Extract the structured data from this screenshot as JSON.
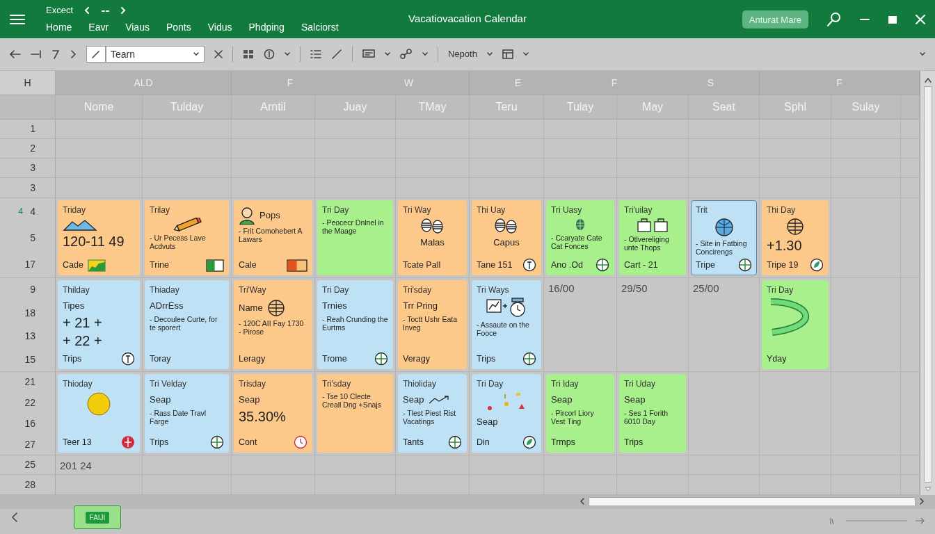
{
  "title_bar": {
    "app_name": "Excect",
    "menu": [
      "Home",
      "Eavr",
      "Viaus",
      "Ponts",
      "Vidus",
      "Phdping",
      "Salciorst"
    ],
    "title": "Vacatiovacation Calendar",
    "account_button": "Anturat Mare"
  },
  "toolbar": {
    "name_field": {
      "value": "Tearn"
    },
    "style_dropdown": "Nepoth"
  },
  "sheet": {
    "corner": "H",
    "column_groups": [
      {
        "labels": [
          "ALD"
        ]
      },
      {
        "labels": [
          "F",
          "W"
        ]
      },
      {
        "labels": [
          "E",
          "F",
          "S"
        ]
      },
      {
        "labels": [
          "F"
        ]
      }
    ],
    "day_headers": [
      "Nome",
      "Tulday",
      "Arntil",
      "Juay",
      "TMay",
      "Teru",
      "Tulay",
      "May",
      "Seat",
      "Sphl",
      "Sulay"
    ],
    "rows": [
      {
        "numbers": [
          "1"
        ]
      },
      {
        "numbers": [
          "2"
        ]
      },
      {
        "numbers": [
          "3"
        ]
      },
      {
        "numbers": [
          "3"
        ]
      },
      {
        "numbers": [
          "4",
          "5",
          "17"
        ],
        "flag": "4",
        "cells": [
          {
            "kind": "card",
            "color": "#fdc98a",
            "selected": false,
            "title": "Triday",
            "values": [
              "120-11 49"
            ],
            "footer": "Cade"
          },
          {
            "kind": "card",
            "color": "#fdc98a",
            "selected": false,
            "title": "Trilay",
            "text": "- Ur Pecess Lave Acdvuts",
            "footer": "Trine"
          },
          {
            "kind": "card",
            "color": "#fdc98a",
            "selected": false,
            "subtitle": "Pops",
            "text": "- Frit Comohebert A Lawars",
            "footer": "Cale"
          },
          {
            "kind": "card",
            "color": "#a8f08c",
            "selected": false,
            "title": "Tri Day",
            "text": "- Peocecr Dnlnel in the Maage"
          },
          {
            "kind": "card",
            "color": "#fdc98a",
            "selected": false,
            "title": "Tri Way",
            "caption": "Malas",
            "footer": "Tcate Pall"
          },
          {
            "kind": "card",
            "color": "#fdc98a",
            "selected": false,
            "title": "Thi Uay",
            "caption": "Capus",
            "footer": "Tane 151"
          },
          {
            "kind": "card",
            "color": "#a8f08c",
            "selected": false,
            "title": "Tri Uasy",
            "text": "- Ccaryate Cate Cat Fonces",
            "footer": "Ano .Od"
          },
          {
            "kind": "card",
            "color": "#a8f08c",
            "selected": false,
            "title": "Tri'uilay",
            "text": "- Otlvereliging unte Thops",
            "footer": "Cart - 21"
          },
          {
            "kind": "card",
            "color": "#bfe1f6",
            "selected": true,
            "title": "Trit",
            "text": "- Site in Fatbing Concirengs",
            "footer": "Tripe"
          },
          {
            "kind": "card",
            "color": "#fdc98a",
            "selected": false,
            "title": "Thi Day",
            "values": [
              "+1.30"
            ],
            "footer": "Tripe 19"
          },
          {
            "kind": "empty"
          }
        ]
      },
      {
        "numbers": [
          "9",
          "18",
          "13",
          "15"
        ],
        "cells": [
          {
            "kind": "card",
            "color": "#bfe1f6",
            "selected": false,
            "title": "Thilday",
            "subtitle": "Tipes",
            "values": [
              "+ 21 +",
              "+ 22 +"
            ],
            "footer": "Trips"
          },
          {
            "kind": "card",
            "color": "#bfe1f6",
            "selected": false,
            "title": "Thiaday",
            "subtitle": "ADrrEss",
            "text": "- Decoulee Curte, for te sporert",
            "footer": "Toray"
          },
          {
            "kind": "card",
            "color": "#fdc98a",
            "selected": false,
            "title": "Tri'Way",
            "subtitle": "Name",
            "text": "- 120C AII Fay 1730 - Pirose",
            "footer": "Leragy"
          },
          {
            "kind": "card",
            "color": "#bfe1f6",
            "selected": false,
            "title": "Tri Day",
            "subtitle": "Trnies",
            "text": "- Reah Crunding the Eurtms",
            "footer": "Trome"
          },
          {
            "kind": "card",
            "color": "#fdc98a",
            "selected": false,
            "title": "Tri'sday",
            "subtitle": "Trr Pring",
            "text": "- Toctt Ushr Eata Inveg",
            "footer": "Veragy"
          },
          {
            "kind": "card",
            "color": "#bfe1f6",
            "selected": false,
            "title": "Tri Ways",
            "text": "- Assaute on the Fooce",
            "footer": "Trips"
          },
          {
            "kind": "text",
            "text": "16/00"
          },
          {
            "kind": "text",
            "text": "29/50"
          },
          {
            "kind": "text",
            "text": "25/00"
          },
          {
            "kind": "card",
            "color": "#a8f08c",
            "selected": false,
            "title": "Tri Day",
            "footer": "Yday"
          },
          {
            "kind": "empty"
          }
        ]
      },
      {
        "numbers": [
          "21",
          "22",
          "16",
          "27"
        ],
        "cells": [
          {
            "kind": "card",
            "color": "#bfe1f6",
            "selected": false,
            "title": "Thioday",
            "footer": "Teer 13"
          },
          {
            "kind": "card",
            "color": "#bfe1f6",
            "selected": false,
            "title": "Tri Velday",
            "subtitle": "Seap",
            "text": "- Rass Date Travl Farge",
            "footer": "Trips"
          },
          {
            "kind": "card",
            "color": "#fdc98a",
            "selected": false,
            "title": "Trisday",
            "subtitle": "Seap",
            "values": [
              "35.30%"
            ],
            "footer": "Cont"
          },
          {
            "kind": "card",
            "color": "#fdc98a",
            "selected": false,
            "title": "Tri'sday",
            "text": "- Tse 10 Clecte Creall Dng +Snajs"
          },
          {
            "kind": "card",
            "color": "#bfe1f6",
            "selected": false,
            "title": "Thioliday",
            "subtitle": "Seap",
            "text": "- Tlest Piest Rist Vacatings",
            "footer": "Tants"
          },
          {
            "kind": "card",
            "color": "#bfe1f6",
            "selected": false,
            "title": "Tri Day",
            "subtitle": "Seap",
            "footer": "Din"
          },
          {
            "kind": "card",
            "color": "#a8f08c",
            "selected": false,
            "title": "Tri Iday",
            "subtitle": "Seap",
            "text": "- Pircorl Liory Vest Ting",
            "footer": "Trmps"
          },
          {
            "kind": "card",
            "color": "#a8f08c",
            "selected": false,
            "title": "Tri Uday",
            "subtitle": "Seap",
            "text": "- Ses 1 Forith 6010 Day",
            "footer": "Trips"
          }
        ]
      },
      {
        "numbers": [
          "25"
        ],
        "cells": [
          {
            "kind": "text",
            "text": "201 24"
          }
        ]
      },
      {
        "numbers": [
          "28"
        ]
      }
    ]
  },
  "sheet_tabs": [
    {
      "label": "FAIJI",
      "selected": true
    }
  ]
}
